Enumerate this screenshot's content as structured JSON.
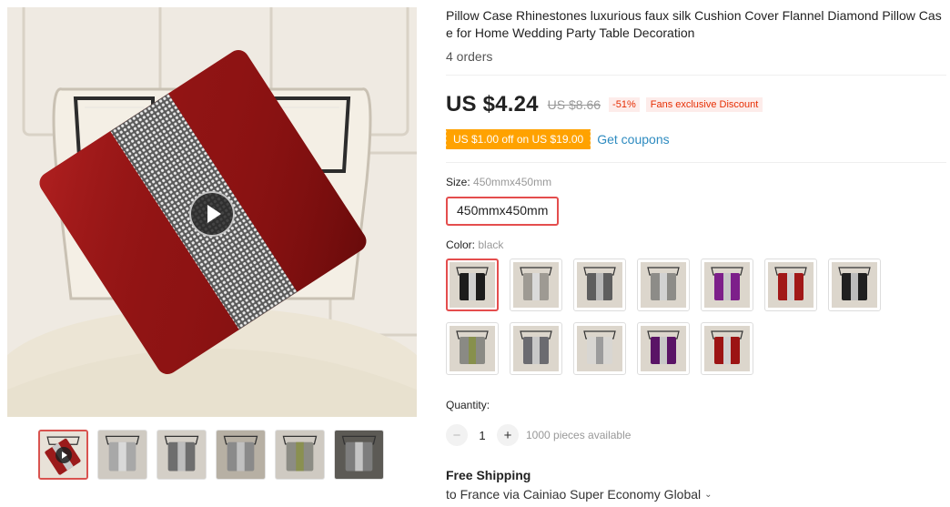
{
  "gallery": {
    "main_image_alt": "",
    "thumbnails": [
      {
        "name": "thumb-video",
        "pillow": "#9b1b1b",
        "band": "#c9c9c9",
        "bg": "#e8e2d8",
        "video": true
      },
      {
        "name": "thumb-grey-pillow",
        "pillow": "#a8a8a8",
        "band": "#d9d9d9",
        "bg": "#cfcac2",
        "video": false
      },
      {
        "name": "thumb-dark-grey-pillow",
        "pillow": "#6e6e6e",
        "band": "#bdbdbd",
        "bg": "#d4cfc7",
        "video": false
      },
      {
        "name": "thumb-room-scene",
        "pillow": "#8a8a8a",
        "band": "#c0c0c0",
        "bg": "#b7b0a4",
        "video": false
      },
      {
        "name": "thumb-olive-pillow",
        "pillow": "#8c8c84",
        "band": "#8a9050",
        "bg": "#cfcac2",
        "video": false
      },
      {
        "name": "thumb-window-scene",
        "pillow": "#7d7d7d",
        "band": "#c4c4c4",
        "bg": "#5c5a55",
        "video": false
      }
    ]
  },
  "product": {
    "title": "Pillow Case Rhinestones luxurious faux silk Cushion Cover Flannel Diamond Pillow Case for Home Wedding Party Table Decoration",
    "orders": "4 orders",
    "price": "US $4.24",
    "old_price": "US $8.66",
    "discount": "-51%",
    "fans_badge": "Fans exclusive Discount",
    "coupon": "US $1.00 off on US $19.00",
    "get_coupons": "Get coupons",
    "size_label": "Size:",
    "size_value": "450mmx450mm",
    "size_option": "450mmx450mm",
    "color_label": "Color:",
    "color_value": "black",
    "colors": [
      {
        "name": "black",
        "body": "#1c1c1c",
        "band": "#cfcfcf"
      },
      {
        "name": "silver-grey",
        "body": "#9e9a93",
        "band": "#dadada"
      },
      {
        "name": "dark-grey",
        "body": "#5e5e5e",
        "band": "#b8b8b8"
      },
      {
        "name": "light-grey",
        "body": "#8d8c88",
        "band": "#d2d2d2"
      },
      {
        "name": "purple",
        "body": "#7d1f8a",
        "band": "#c7c7c7"
      },
      {
        "name": "red",
        "body": "#a11818",
        "band": "#cfcfcf"
      },
      {
        "name": "black-2",
        "body": "#202020",
        "band": "#bcbcbc"
      },
      {
        "name": "grey-olive",
        "body": "#8a8a84",
        "band": "#87904c"
      },
      {
        "name": "grey-stripe",
        "body": "#6b6b70",
        "band": "#c8c8c8"
      },
      {
        "name": "white-grey",
        "body": "#d8d6d2",
        "band": "#9c9c9c"
      },
      {
        "name": "violet",
        "body": "#5a1466",
        "band": "#c8c8c8"
      },
      {
        "name": "crimson",
        "body": "#9c1414",
        "band": "#cfcfcf"
      }
    ],
    "quantity_label": "Quantity:",
    "quantity": "1",
    "minus": "−",
    "plus": "+",
    "available": "1000 pieces available",
    "shipping_title": "Free Shipping",
    "shipping_detail": "to France via Cainiao Super Economy Global"
  }
}
